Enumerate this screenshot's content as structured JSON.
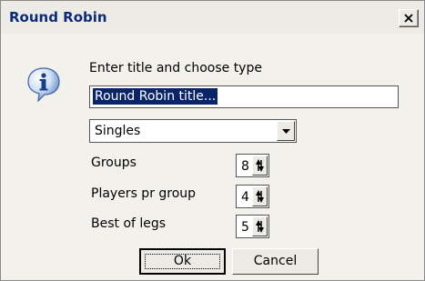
{
  "window": {
    "title": "Round Robin",
    "close_icon": "close-icon"
  },
  "dialog": {
    "icon": "info-icon",
    "prompt": "Enter title and choose type",
    "title_value": "Round Robin title...",
    "type_value": "Singles",
    "fields": [
      {
        "label": "Groups",
        "value": "8"
      },
      {
        "label": "Players pr group",
        "value": "4"
      },
      {
        "label": "Best of legs",
        "value": "5"
      }
    ]
  },
  "buttons": {
    "ok": "Ok",
    "cancel": "Cancel"
  },
  "colors": {
    "title_text": "#0b2a78",
    "selection": "#0a246a",
    "dialog_bg": "#f2f1eb"
  }
}
